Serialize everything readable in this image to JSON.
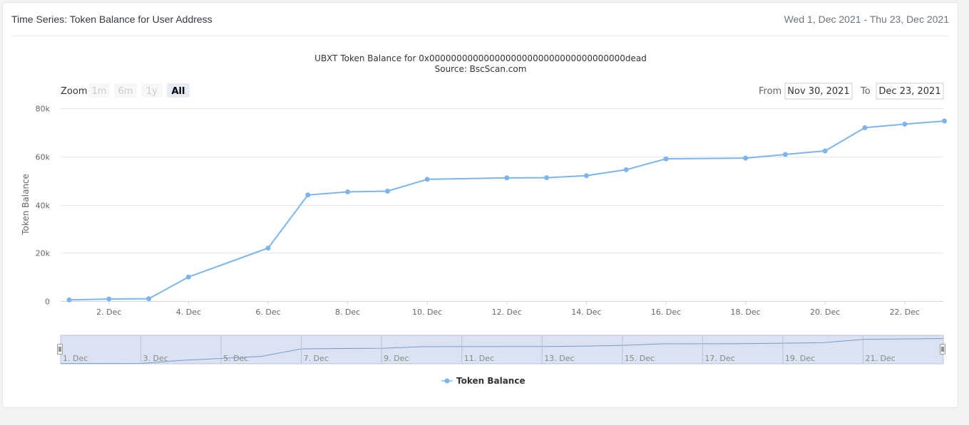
{
  "header": {
    "title": "Time Series: Token Balance for User Address",
    "date_range": "Wed 1, Dec 2021 - Thu 23, Dec 2021"
  },
  "range_selector": {
    "zoom_label": "Zoom",
    "buttons": [
      {
        "label": "1m",
        "state": "disabled"
      },
      {
        "label": "6m",
        "state": "disabled"
      },
      {
        "label": "1y",
        "state": "disabled"
      },
      {
        "label": "All",
        "state": "selected"
      }
    ],
    "from_label": "From",
    "from_value": "Nov 30, 2021",
    "to_label": "To",
    "to_value": "Dec 23, 2021"
  },
  "navigator": {
    "ticks": [
      "1. Dec",
      "3. Dec",
      "5. Dec",
      "7. Dec",
      "9. Dec",
      "11. Dec",
      "13. Dec",
      "15. Dec",
      "17. Dec",
      "19. Dec",
      "21. Dec"
    ]
  },
  "colors": {
    "series": "#7cb5ec",
    "grid": "#e6e6e6",
    "navigator_fill": "#ccd6eb",
    "button_selected": "#e6ebf5"
  },
  "chart_data": {
    "type": "line",
    "title": "UBXT Token Balance for 0x000000000000000000000000000000000000dead",
    "subtitle": "Source: BscScan.com",
    "ylabel": "Token Balance",
    "ylim": [
      0,
      80000
    ],
    "yticks": [
      0,
      20000,
      40000,
      60000,
      80000
    ],
    "ytick_labels": [
      "0",
      "20k",
      "40k",
      "60k",
      "80k"
    ],
    "xticks": [
      "2. Dec",
      "4. Dec",
      "6. Dec",
      "8. Dec",
      "10. Dec",
      "12. Dec",
      "14. Dec",
      "16. Dec",
      "18. Dec",
      "20. Dec",
      "22. Dec"
    ],
    "x": [
      "2021-12-01",
      "2021-12-02",
      "2021-12-03",
      "2021-12-04",
      "2021-12-06",
      "2021-12-07",
      "2021-12-08",
      "2021-12-09",
      "2021-12-10",
      "2021-12-12",
      "2021-12-13",
      "2021-12-14",
      "2021-12-15",
      "2021-12-16",
      "2021-12-18",
      "2021-12-19",
      "2021-12-20",
      "2021-12-21",
      "2021-12-22",
      "2021-12-23"
    ],
    "series": [
      {
        "name": "Token Balance",
        "values": [
          500,
          900,
          1000,
          10000,
          22000,
          44000,
          45300,
          45600,
          50500,
          51100,
          51200,
          52000,
          54500,
          59000,
          59300,
          60800,
          62300,
          71900,
          73400,
          74700
        ]
      }
    ],
    "grid": true,
    "legend": "bottom-center"
  }
}
